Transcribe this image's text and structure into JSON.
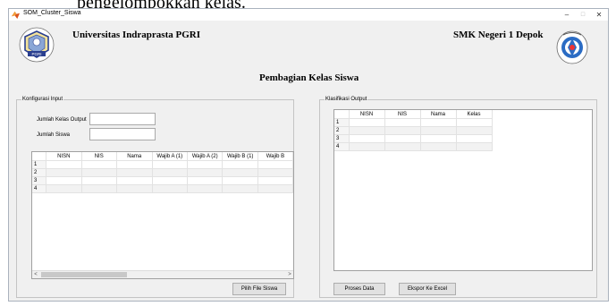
{
  "caption": "pengelompokkan kelas.",
  "window": {
    "title": "SOM_Cluster_Siswa",
    "min": "–",
    "max": "□",
    "close": "✕"
  },
  "header": {
    "left_logo_text": "PGRI",
    "university": "Universitas Indraprasta PGRI",
    "school": "SMK Negeri 1 Depok",
    "heading": "Pembagian Kelas Siswa"
  },
  "input_panel": {
    "title": "Konfigurasi Input",
    "jumlah_kelas_label": "Jumlah Kelas Output",
    "jumlah_kelas_value": "",
    "jumlah_siswa_label": "Jumlah Siswa",
    "jumlah_siswa_value": "",
    "columns": [
      "NISN",
      "NIS",
      "Nama",
      "Wajib A (1)",
      "Wajib A (2)",
      "Wajib B (1)",
      "Wajib B"
    ],
    "rows": [
      "1",
      "2",
      "3",
      "4"
    ],
    "scroll_left": "<",
    "scroll_right": ">",
    "pick_button": "Pilih File Siswa"
  },
  "output_panel": {
    "title": "Klasifikasi Output",
    "columns": [
      "NISN",
      "NIS",
      "Nama",
      "Kelas"
    ],
    "rows": [
      "1",
      "2",
      "3",
      "4"
    ],
    "process_button": "Proses Data",
    "export_button": "Ekspor Ke Excel"
  }
}
